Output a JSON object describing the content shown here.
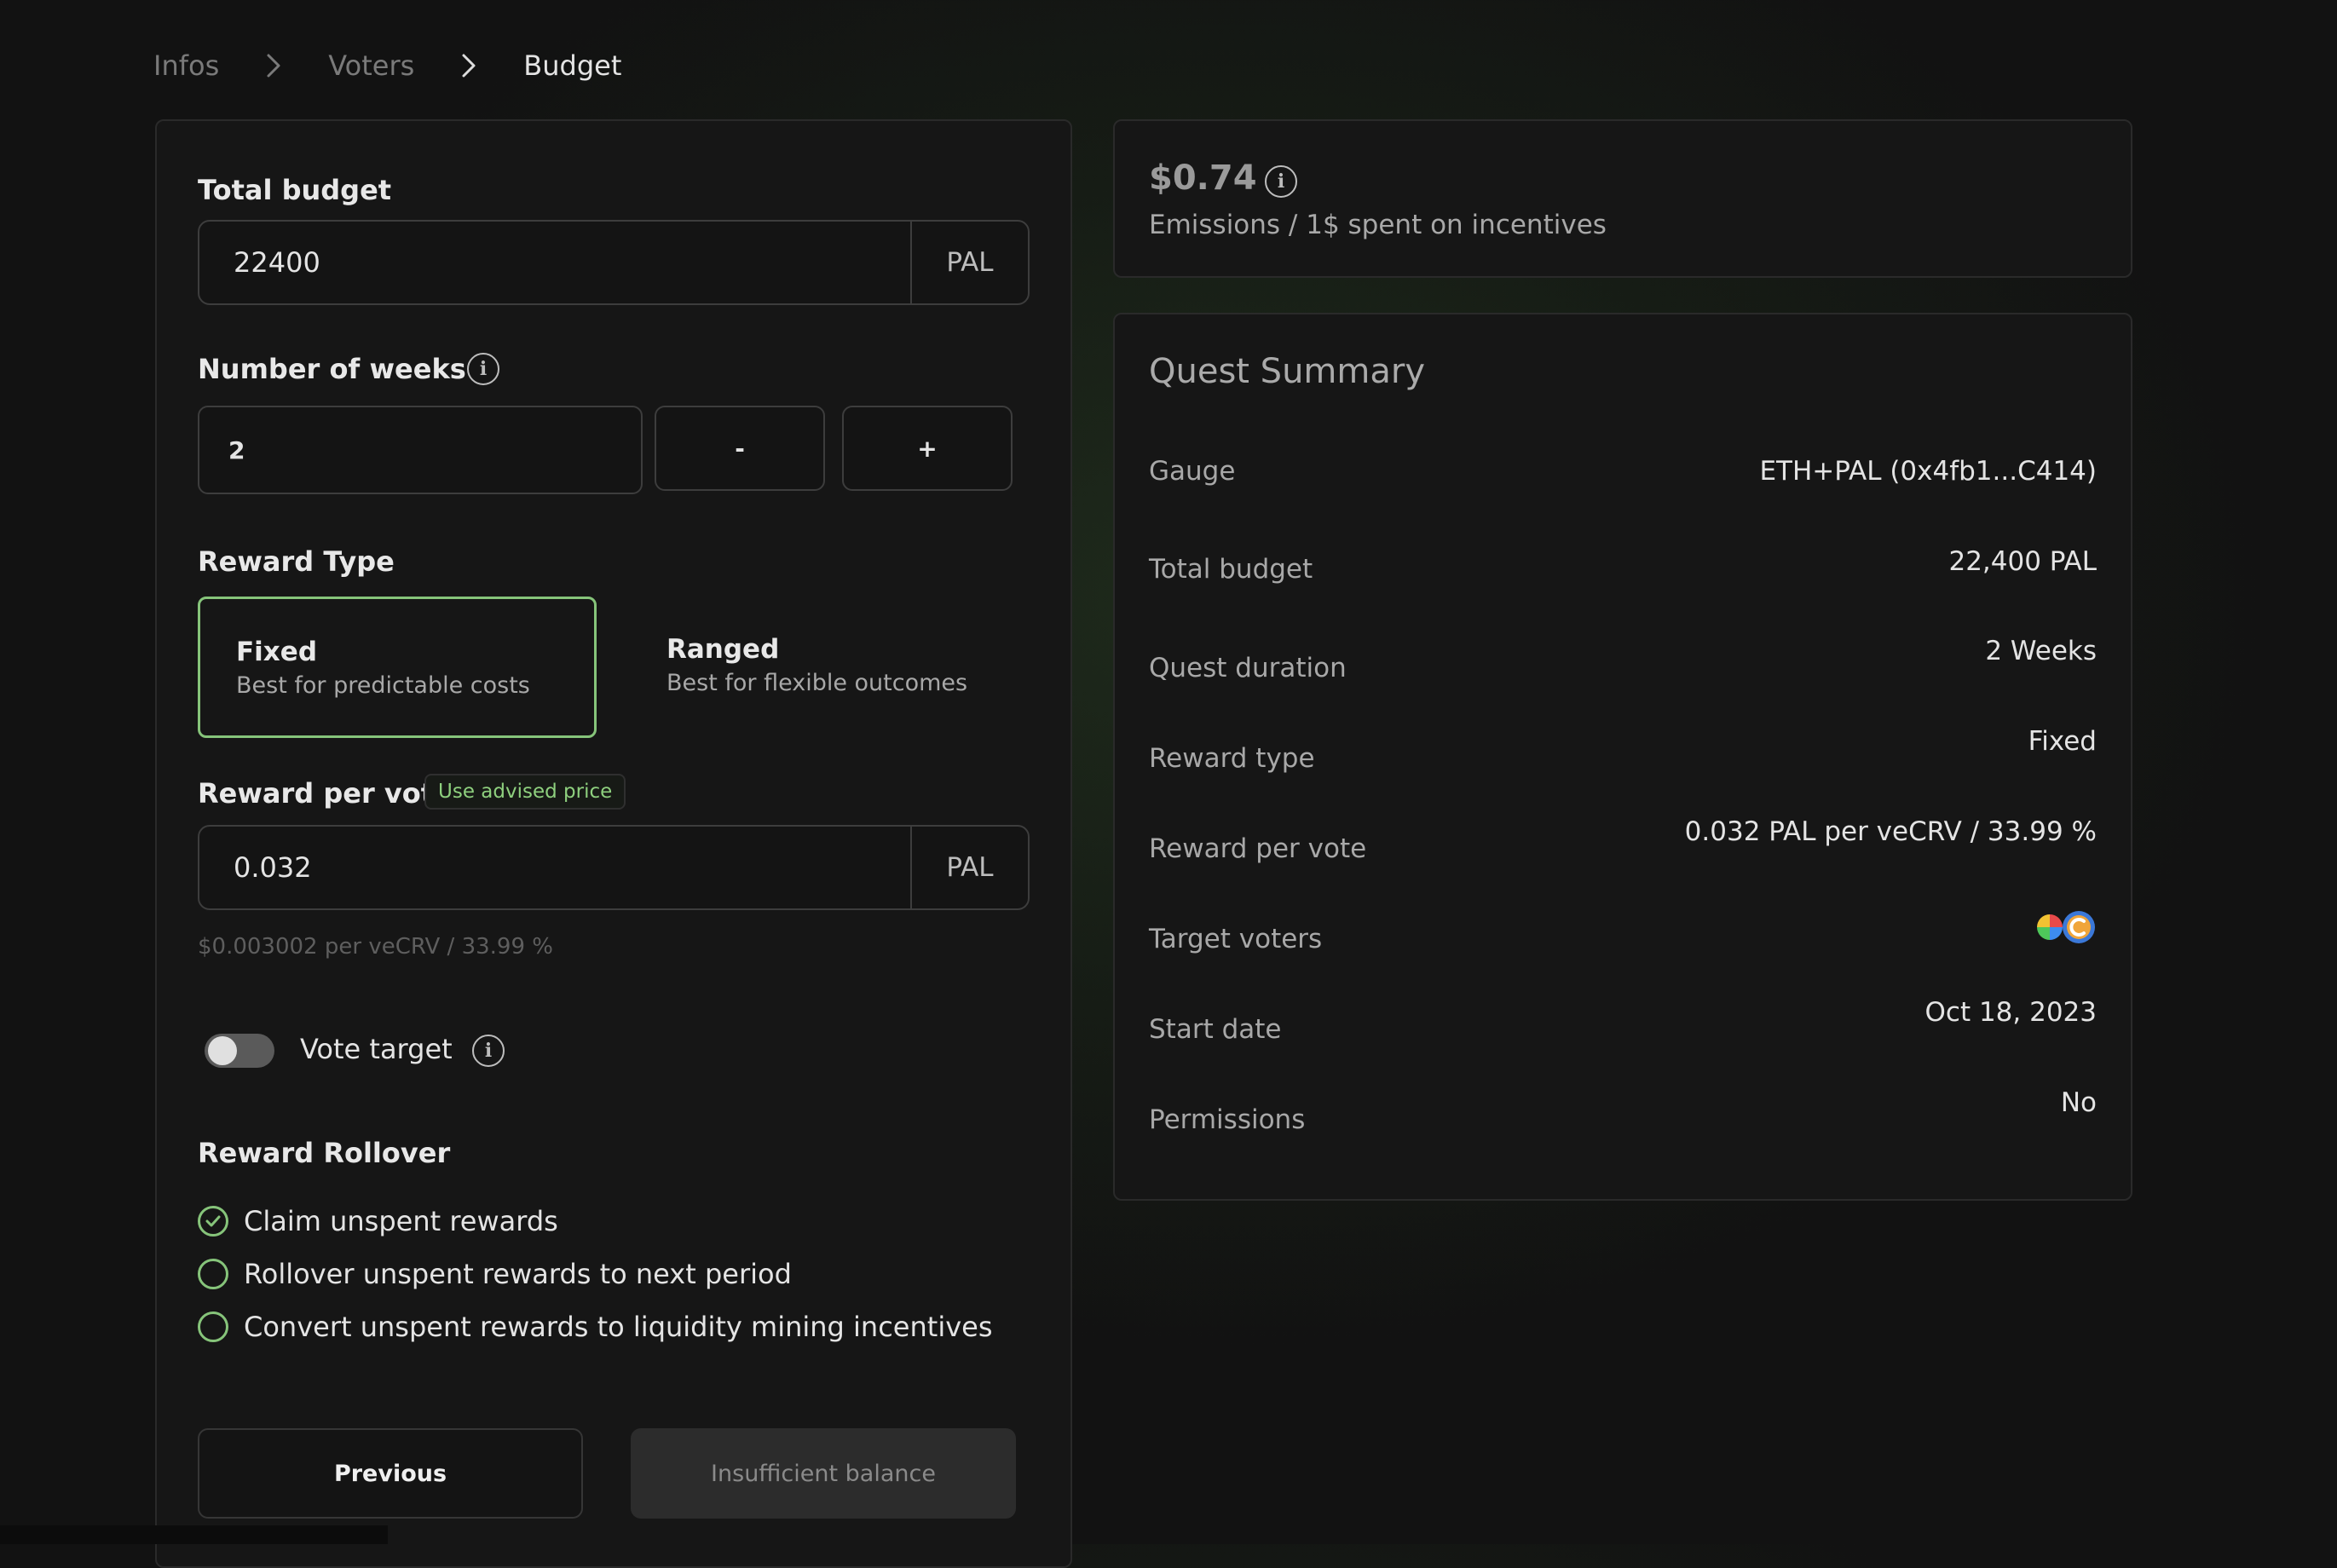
{
  "breadcrumb": {
    "items": [
      "Infos",
      "Voters",
      "Budget"
    ]
  },
  "form": {
    "total_budget": {
      "label": "Total budget",
      "value": "22400",
      "unit": "PAL"
    },
    "weeks": {
      "label": "Number of weeks",
      "value": "2",
      "decrement": "-",
      "increment": "+"
    },
    "reward_type": {
      "label": "Reward Type",
      "options": [
        {
          "title": "Fixed",
          "subtitle": "Best for predictable costs",
          "selected": true
        },
        {
          "title": "Ranged",
          "subtitle": "Best for flexible outcomes",
          "selected": false
        }
      ]
    },
    "reward_per_vote": {
      "label": "Reward per vote",
      "advised_label": "Use advised price",
      "value": "0.032",
      "unit": "PAL",
      "hint": "$0.003002 per veCRV / 33.99 %"
    },
    "vote_target": {
      "label": "Vote target",
      "enabled": false
    },
    "rollover": {
      "label": "Reward Rollover",
      "options": [
        {
          "label": "Claim unspent rewards",
          "checked": true
        },
        {
          "label": "Rollover unspent rewards to next period",
          "checked": false
        },
        {
          "label": "Convert unspent rewards to liquidity mining incentives",
          "checked": false
        }
      ]
    },
    "buttons": {
      "previous": "Previous",
      "submit": "Insufficient balance"
    }
  },
  "emissions": {
    "value": "$0.74",
    "label": "Emissions / 1$ spent on incentives"
  },
  "summary": {
    "title": "Quest Summary",
    "rows": [
      {
        "label": "Gauge",
        "value": "ETH+PAL (0x4fb1...C414)"
      },
      {
        "label": "Total budget",
        "value": "22,400 PAL"
      },
      {
        "label": "Quest duration",
        "value": "2 Weeks"
      },
      {
        "label": "Reward type",
        "value": "Fixed"
      },
      {
        "label": "Reward per vote",
        "value": "0.032 PAL per veCRV / 33.99 %"
      },
      {
        "label": "Target voters",
        "value": ""
      },
      {
        "label": "Start date",
        "value": "Oct 18, 2023"
      },
      {
        "label": "Permissions",
        "value": "No"
      }
    ]
  },
  "colors": {
    "accent": "#86c47a",
    "background": "#121212",
    "panel": "#161616"
  }
}
